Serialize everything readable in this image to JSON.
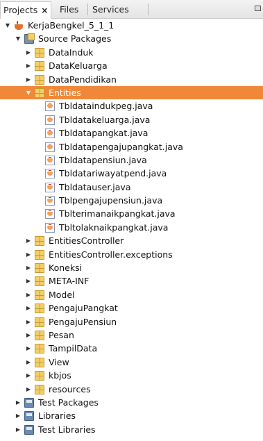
{
  "tabs": [
    {
      "label": "Projects",
      "close": "×",
      "active": true
    },
    {
      "label": "Files",
      "active": false
    },
    {
      "label": "Services",
      "active": false
    }
  ],
  "tree": [
    {
      "depth": 0,
      "toggle": "▼",
      "icon": "project",
      "label": "KerjaBengkel_5_1_1"
    },
    {
      "depth": 1,
      "toggle": "▼",
      "icon": "source-packages",
      "label": "Source Packages"
    },
    {
      "depth": 2,
      "toggle": "▶",
      "icon": "package",
      "label": "DataInduk"
    },
    {
      "depth": 2,
      "toggle": "▶",
      "icon": "package",
      "label": "DataKeluarga"
    },
    {
      "depth": 2,
      "toggle": "▶",
      "icon": "package",
      "label": "DataPendidikan"
    },
    {
      "depth": 2,
      "toggle": "▼",
      "icon": "package",
      "label": "Entities",
      "selected": true
    },
    {
      "depth": 3,
      "toggle": "",
      "icon": "java",
      "label": "Tbldataindukpeg.java"
    },
    {
      "depth": 3,
      "toggle": "",
      "icon": "java",
      "label": "Tbldatakeluarga.java"
    },
    {
      "depth": 3,
      "toggle": "",
      "icon": "java",
      "label": "Tbldatapangkat.java"
    },
    {
      "depth": 3,
      "toggle": "",
      "icon": "java",
      "label": "Tbldatapengajupangkat.java"
    },
    {
      "depth": 3,
      "toggle": "",
      "icon": "java",
      "label": "Tbldatapensiun.java"
    },
    {
      "depth": 3,
      "toggle": "",
      "icon": "java",
      "label": "Tbldatariwayatpend.java"
    },
    {
      "depth": 3,
      "toggle": "",
      "icon": "java",
      "label": "Tbldatauser.java"
    },
    {
      "depth": 3,
      "toggle": "",
      "icon": "java",
      "label": "Tblpengajupensiun.java"
    },
    {
      "depth": 3,
      "toggle": "",
      "icon": "java",
      "label": "Tblterimanaikpangkat.java"
    },
    {
      "depth": 3,
      "toggle": "",
      "icon": "java",
      "label": "Tbltolaknaikpangkat.java"
    },
    {
      "depth": 2,
      "toggle": "▶",
      "icon": "package",
      "label": "EntitiesController"
    },
    {
      "depth": 2,
      "toggle": "▶",
      "icon": "package",
      "label": "EntitiesController.exceptions"
    },
    {
      "depth": 2,
      "toggle": "▶",
      "icon": "package",
      "label": "Koneksi"
    },
    {
      "depth": 2,
      "toggle": "▶",
      "icon": "package",
      "label": "META-INF"
    },
    {
      "depth": 2,
      "toggle": "▶",
      "icon": "package",
      "label": "Model"
    },
    {
      "depth": 2,
      "toggle": "▶",
      "icon": "package",
      "label": "PengajuPangkat"
    },
    {
      "depth": 2,
      "toggle": "▶",
      "icon": "package",
      "label": "PengajuPensiun"
    },
    {
      "depth": 2,
      "toggle": "▶",
      "icon": "package",
      "label": "Pesan"
    },
    {
      "depth": 2,
      "toggle": "▶",
      "icon": "package",
      "label": "TampilData"
    },
    {
      "depth": 2,
      "toggle": "▶",
      "icon": "package",
      "label": "View"
    },
    {
      "depth": 2,
      "toggle": "▶",
      "icon": "package",
      "label": "kbjos"
    },
    {
      "depth": 2,
      "toggle": "▶",
      "icon": "package",
      "label": "resources"
    },
    {
      "depth": 1,
      "toggle": "▶",
      "icon": "folder",
      "label": "Test Packages"
    },
    {
      "depth": 1,
      "toggle": "▶",
      "icon": "folder",
      "label": "Libraries"
    },
    {
      "depth": 1,
      "toggle": "▶",
      "icon": "folder",
      "label": "Test Libraries"
    }
  ],
  "colors": {
    "selection": "#f0883a",
    "package": "#f1cf6a"
  }
}
